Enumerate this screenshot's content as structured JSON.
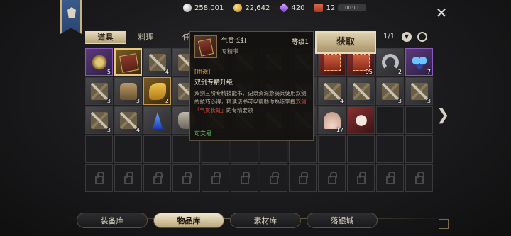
{
  "resources": {
    "silver": "258,001",
    "gold": "22,642",
    "gems": "420",
    "tickets": "12",
    "timer": "00:11"
  },
  "tabs": [
    "道具",
    "料理",
    "任"
  ],
  "active_tab": 0,
  "tooltip": {
    "name": "气贯长虹",
    "type": "专精书",
    "level": "等级1",
    "section": "[用途]",
    "title": "双剑专精升级",
    "desc_pre": "双剑三阶专精技能书，记录资深游骑兵使用双剑的技巧心得，精读该书可以帮助你熟练掌握",
    "desc_hl": "双剑「气贯长虹」",
    "desc_post": "的专精要领",
    "trade": "可交易"
  },
  "get_button": "获取",
  "pagination": "1/1",
  "grid": [
    [
      {
        "t": "purple",
        "a": "gear",
        "c": "5"
      },
      {
        "t": "gold",
        "a": "book",
        "sel": true
      },
      {
        "t": "item",
        "a": "sword",
        "c": "4"
      },
      {
        "t": "item",
        "a": "sword"
      },
      {
        "t": "item",
        "a": "sword"
      },
      {
        "t": "item",
        "a": "sword"
      },
      {
        "t": "item",
        "a": "sword"
      },
      {
        "t": "item",
        "a": "sword"
      },
      {
        "t": "red",
        "a": "ticket"
      },
      {
        "t": "red",
        "a": "ticket",
        "c": "95"
      },
      {
        "t": "item",
        "a": "horseshoe",
        "c": "2"
      },
      {
        "t": "purple",
        "a": "butterfly",
        "c": "7"
      }
    ],
    [
      {
        "t": "item",
        "a": "sword",
        "c": "3"
      },
      {
        "t": "item",
        "a": "bag",
        "c": "3"
      },
      {
        "t": "gold",
        "a": "fish",
        "c": "2"
      },
      {
        "t": "item",
        "a": "sword"
      },
      {
        "t": "item",
        "a": "sword"
      },
      {
        "t": "item",
        "a": "sword"
      },
      {
        "t": "item",
        "a": "sword"
      },
      {
        "t": "item",
        "a": "sword"
      },
      {
        "t": "item",
        "a": "sword",
        "c": "4"
      },
      {
        "t": "item",
        "a": "sword"
      },
      {
        "t": "item",
        "a": "sword",
        "c": "3"
      },
      {
        "t": "item",
        "a": "sword",
        "c": "3"
      }
    ],
    [
      {
        "t": "item",
        "a": "sword",
        "c": "3"
      },
      {
        "t": "item",
        "a": "sword",
        "c": "4"
      },
      {
        "t": "item",
        "a": "crystal"
      },
      {
        "t": "item",
        "a": "jar",
        "c": "1"
      },
      {
        "t": "item",
        "a": "sword"
      },
      {
        "t": "item",
        "a": "sword"
      },
      {
        "t": "item",
        "a": "sword"
      },
      {
        "t": "item",
        "a": "sword"
      },
      {
        "t": "item",
        "a": "shell",
        "c": "17"
      },
      {
        "t": "red",
        "a": "cat"
      },
      {
        "t": "empty"
      },
      {
        "t": "empty"
      }
    ],
    [
      {
        "t": "empty"
      },
      {
        "t": "empty"
      },
      {
        "t": "empty"
      },
      {
        "t": "empty"
      },
      {
        "t": "empty"
      },
      {
        "t": "empty"
      },
      {
        "t": "empty"
      },
      {
        "t": "empty"
      },
      {
        "t": "empty"
      },
      {
        "t": "empty"
      },
      {
        "t": "empty"
      },
      {
        "t": "empty"
      }
    ],
    [
      {
        "t": "lock"
      },
      {
        "t": "lock"
      },
      {
        "t": "lock"
      },
      {
        "t": "lock"
      },
      {
        "t": "lock"
      },
      {
        "t": "lock"
      },
      {
        "t": "lock"
      },
      {
        "t": "lock"
      },
      {
        "t": "lock"
      },
      {
        "t": "lock"
      },
      {
        "t": "lock"
      },
      {
        "t": "lock"
      }
    ]
  ],
  "bottom_tabs": [
    "装备库",
    "物品库",
    "素材库",
    "落银城"
  ],
  "active_bottom_tab": 1
}
